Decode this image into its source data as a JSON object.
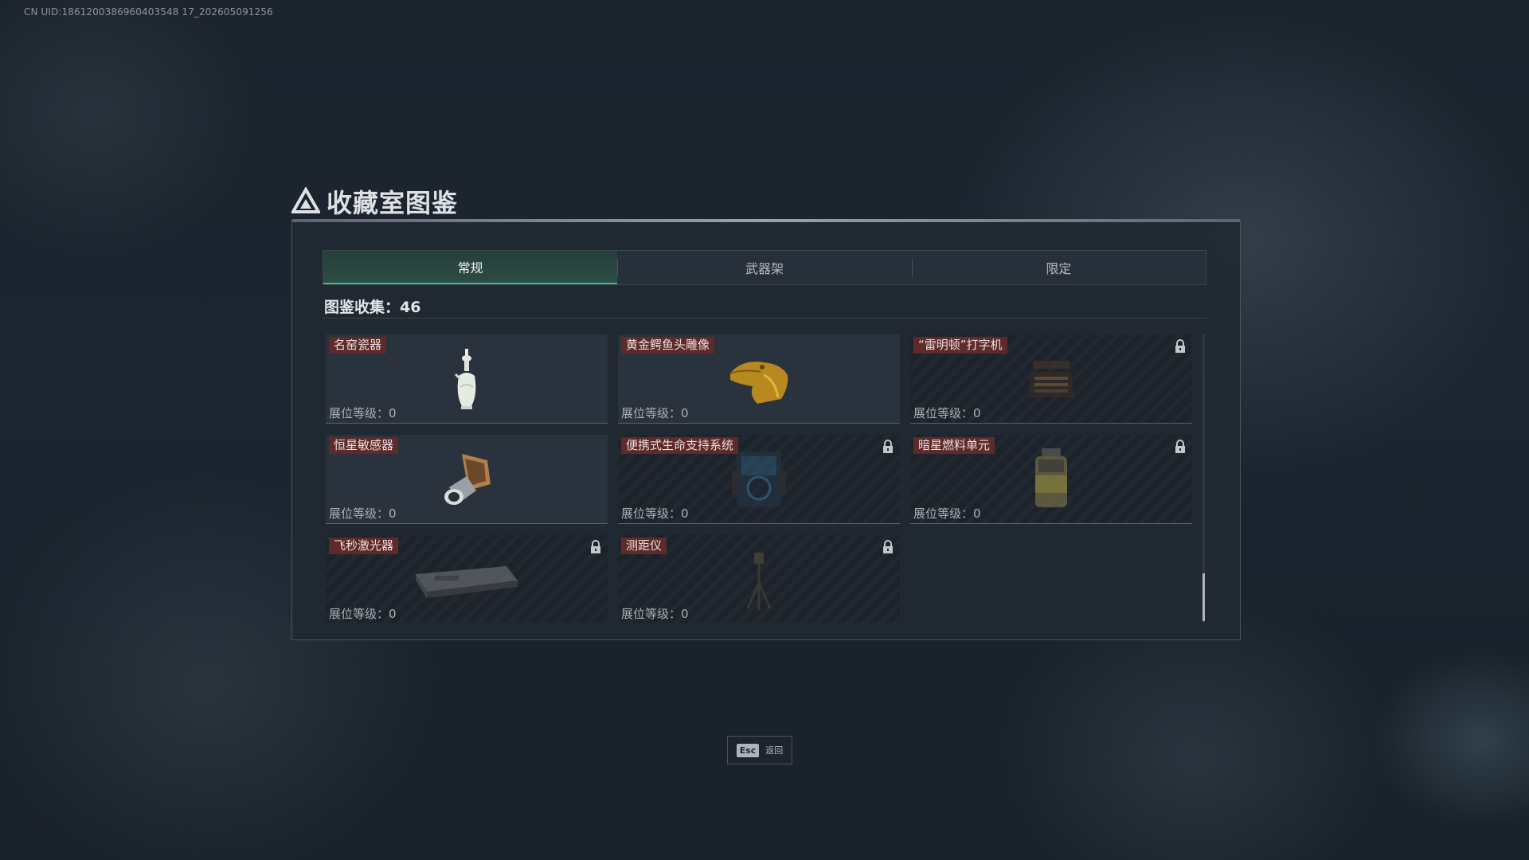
{
  "uid_text": "CN UID:1861200386960403548 17_202605091256",
  "header": {
    "title": "收藏室图鉴"
  },
  "tabs": [
    {
      "label": "常规",
      "active": true
    },
    {
      "label": "武器架",
      "active": false
    },
    {
      "label": "限定",
      "active": false
    }
  ],
  "collection": {
    "text": "图鉴收集：46"
  },
  "items": [
    {
      "name": "名窑瓷器",
      "level": "展位等级：0",
      "locked": false,
      "icon": "porcelain-vase-icon"
    },
    {
      "name": "黄金鳄鱼头雕像",
      "level": "展位等级：0",
      "locked": false,
      "icon": "golden-crocodile-head-icon"
    },
    {
      "name": "“雷明顿”打字机",
      "level": "展位等级：0",
      "locked": true,
      "icon": "typewriter-icon"
    },
    {
      "name": "恒星敏感器",
      "level": "展位等级：0",
      "locked": false,
      "icon": "star-sensor-icon"
    },
    {
      "name": "便携式生命支持系统",
      "level": "展位等级：0",
      "locked": true,
      "icon": "life-support-icon"
    },
    {
      "name": "暗星燃料单元",
      "level": "展位等级：0",
      "locked": true,
      "icon": "fuel-cell-icon"
    },
    {
      "name": "飞秒激光器",
      "level": "展位等级：0",
      "locked": true,
      "icon": "femtosecond-laser-icon"
    },
    {
      "name": "测距仪",
      "level": "展位等级：0",
      "locked": true,
      "icon": "rangefinder-icon"
    }
  ],
  "footer": {
    "key": "Esc",
    "label": "返回"
  },
  "colors": {
    "accent": "#3fb37d",
    "tag_bg": "#5e2a2a"
  }
}
